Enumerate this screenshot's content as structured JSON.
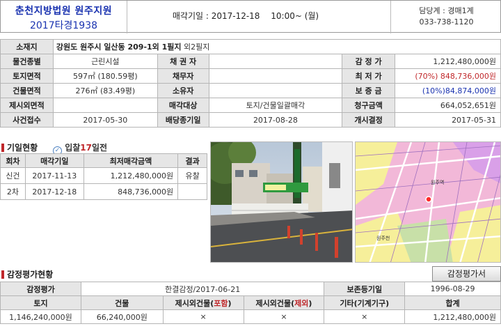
{
  "header": {
    "court_name": "춘천지방법원 원주지원",
    "case_no": "2017타경1938",
    "sale_date_label": "매각기일 : 2017-12-18 　10:00~ (월)",
    "officer": "담당계 : 경매1계",
    "phone": "033-738-1120"
  },
  "info": {
    "address_label": "소재지",
    "address": "강원도 원주시 일산동 209-1외 1필지",
    "address_extra": "외2필지",
    "rows": [
      [
        "물건종별",
        "근린시설",
        "채 권 자",
        "",
        "감 정 가",
        "1,212,480,000원"
      ],
      [
        "토지면적",
        "597㎡ (180.59평)",
        "채무자",
        "",
        "최 저 가",
        "(70%) 848,736,000원"
      ],
      [
        "건물면적",
        "276㎡ (83.49평)",
        "소유자",
        "",
        "보 증 금",
        "(10%)84,874,000원"
      ],
      [
        "제시외면적",
        "",
        "매각대상",
        "토지/건물일괄매각",
        "청구금액",
        "664,052,651원"
      ],
      [
        "사건접수",
        "2017-05-30",
        "배당종기일",
        "2017-08-28",
        "개시결정",
        "2017-05-31"
      ]
    ]
  },
  "history": {
    "title": "기일현황",
    "check_label_prefix": "입찰",
    "check_label_num": "17",
    "check_label_suffix": "일전",
    "headers": [
      "회차",
      "매각기일",
      "최저매각금액",
      "결과"
    ],
    "rows": [
      [
        "신건",
        "2017-11-13",
        "1,212,480,000원",
        "유찰"
      ],
      [
        "2차",
        "2017-12-18",
        "848,736,000원",
        ""
      ]
    ]
  },
  "map_labels": {
    "a": "원주역",
    "b": "원주천"
  },
  "appraisal": {
    "title": "감정평가현황",
    "button": "감정평가서",
    "row1": [
      "감정평가",
      "한결감정/2017-06-21",
      "보존등기일",
      "1996-08-29"
    ],
    "headers": [
      "토지",
      "건물",
      "제시외건물(",
      "포함",
      ")",
      "제시외건물(",
      "제외",
      ")",
      "기타(기계기구)",
      "합계"
    ],
    "values": [
      "1,146,240,000원",
      "66,240,000원",
      "×",
      "×",
      "×",
      "1,212,480,000원"
    ]
  },
  "colors": {
    "accent_red": "#c0282b",
    "court_blue": "#1a33b0",
    "header_gray": "#e6e6e6"
  }
}
